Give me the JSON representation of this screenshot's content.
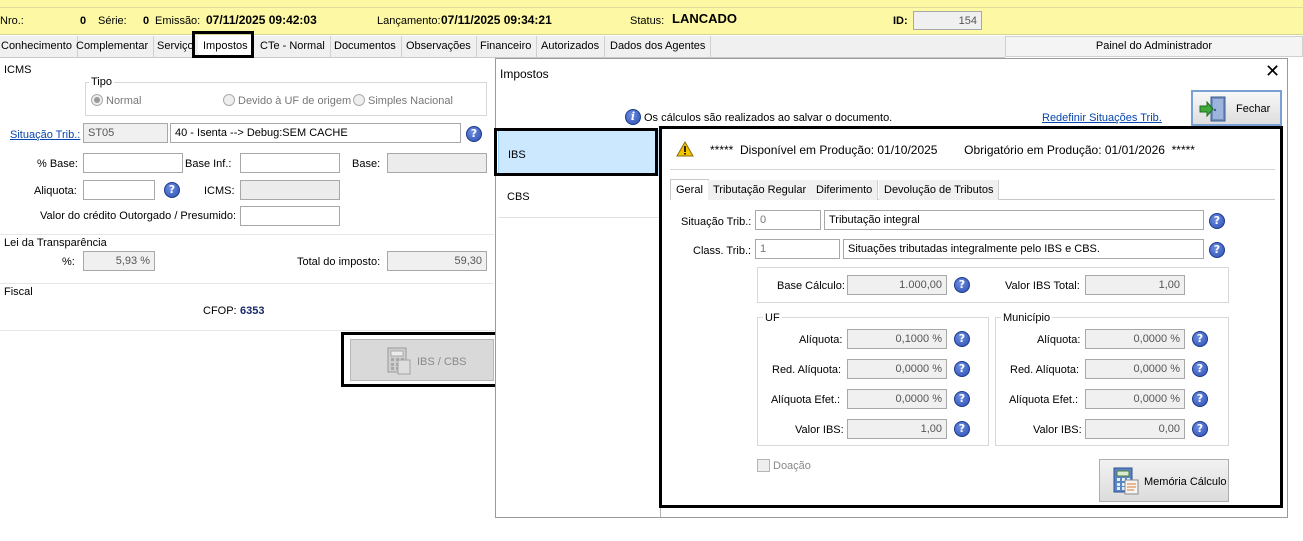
{
  "header": {
    "nro_label": "Nro.:",
    "nro_value": "0",
    "serie_label": "Série:",
    "serie_value": "0",
    "emissao_label": "Emissão:",
    "emissao_value": "07/11/2025 09:42:03",
    "lancamento_label": "Lançamento:",
    "lancamento_value": "07/11/2025 09:34:21",
    "status_label": "Status:",
    "status_value": "LANCADO",
    "id_label": "ID:",
    "id_value": "154"
  },
  "tabs": [
    "Conhecimento",
    "Complementar",
    "Serviço",
    "Impostos",
    "CTe - Normal",
    "Documentos",
    "Observações",
    "Financeiro",
    "Autorizados",
    "Dados dos Agentes"
  ],
  "admin_panel": "Painel do Administrador",
  "icms": {
    "title": "ICMS",
    "tipo_title": "Tipo",
    "tipo_options": [
      "Normal",
      "Devido à UF de origem",
      "Simples Nacional"
    ],
    "situacao_label": "Situação Trib.:",
    "situacao_code": "ST05",
    "situacao_desc": "40 - Isenta    --> Debug:SEM CACHE",
    "base_pct_label": "% Base:",
    "base_inf_label": "Base Inf.:",
    "base_label": "Base:",
    "aliquota_label": "Aliquota:",
    "icms_label": "ICMS:",
    "credito_label": "Valor do crédito Outorgado / Presumido:"
  },
  "transparencia": {
    "title": "Lei da Transparência",
    "pct_label": "%:",
    "pct_value": "5,93 %",
    "total_label": "Total do imposto:",
    "total_value": "59,30"
  },
  "fiscal": {
    "title": "Fiscal",
    "cfop_label": "CFOP:",
    "cfop_value": "6353"
  },
  "ibs_cbs_button": "IBS / CBS",
  "dialog": {
    "title": "Impostos",
    "info_text": "Os cálculos são realizados ao salvar o documento.",
    "redefinir_link": "Redefinir Situações Trib.",
    "fechar": "Fechar",
    "nav_items": [
      "IBS",
      "CBS"
    ],
    "warning_text": "*****  Disponível em Produção: 01/10/2025        Obrigatório em Produção: 01/01/2026  *****",
    "inner_tabs": [
      "Geral",
      "Tributação Regular",
      "Diferimento",
      "Devolução de Tributos"
    ],
    "situacao_label": "Situação Trib.:",
    "situacao_code": "0",
    "situacao_desc": "Tributação integral",
    "class_label": "Class. Trib.:",
    "class_code": "1",
    "class_desc": "Situações tributadas integralmente pelo IBS e CBS.",
    "base_calculo_label": "Base Cálculo:",
    "base_calculo_value": "1.000,00",
    "valor_total_label": "Valor IBS Total:",
    "valor_total_value": "1,00",
    "uf": {
      "title": "UF",
      "aliquota_label": "Alíquota:",
      "aliquota_value": "0,1000 %",
      "red_label": "Red. Alíquota:",
      "red_value": "0,0000 %",
      "efet_label": "Alíquota Efet.:",
      "efet_value": "0,0000 %",
      "valor_label": "Valor IBS:",
      "valor_value": "1,00"
    },
    "municipio": {
      "title": "Município",
      "aliquota_label": "Alíquota:",
      "aliquota_value": "0,0000 %",
      "red_label": "Red. Alíquota:",
      "red_value": "0,0000 %",
      "efet_label": "Alíquota Efet.:",
      "efet_value": "0,0000 %",
      "valor_label": "Valor IBS:",
      "valor_value": "0,00"
    },
    "doacao_label": "Doação",
    "memoria_button": "Memória Cálculo"
  }
}
